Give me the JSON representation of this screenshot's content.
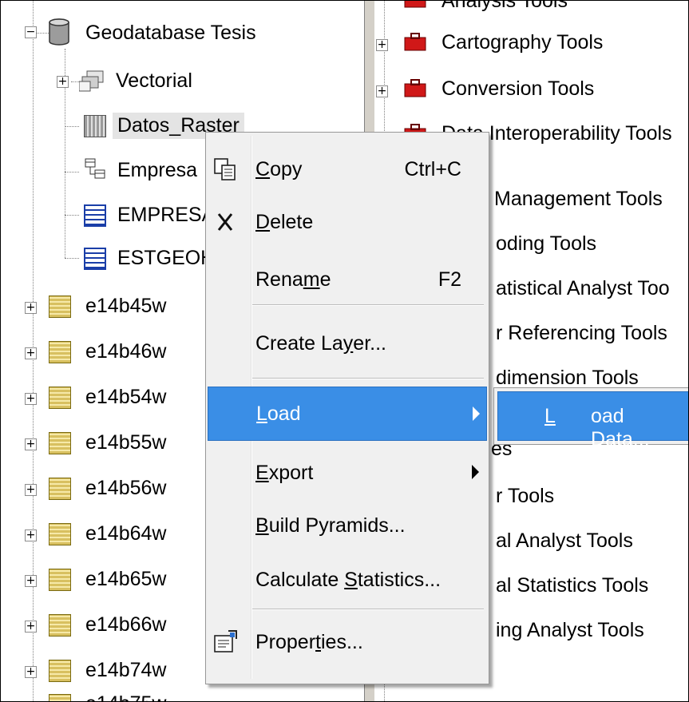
{
  "tree": {
    "root_label": "Geodatabase Tesis",
    "children": [
      {
        "label": "Vectorial",
        "icon": "feature-dataset-icon",
        "expander": "+"
      },
      {
        "label": "Datos_Raster",
        "icon": "raster-catalog-icon"
      },
      {
        "label": "Empresa",
        "icon": "relationship-class-icon"
      },
      {
        "label": "EMPRESA",
        "icon": "table-icon"
      },
      {
        "label": "ESTGEOH",
        "icon": "table-icon"
      }
    ],
    "rasters": [
      "e14b45w",
      "e14b46w",
      "e14b54w",
      "e14b55w",
      "e14b56w",
      "e14b64w",
      "e14b65w",
      "e14b66w",
      "e14b74w",
      "e14b75w"
    ],
    "expander_symbol": "+",
    "root_expander_symbol": "−"
  },
  "toolbox": {
    "items": [
      "Analysis Tools",
      "Cartography Tools",
      "Conversion Tools",
      "Data Interoperability Tools",
      "Data Management Tools",
      "Geocoding Tools",
      "Geostatistical Analyst Tools",
      "Linear Referencing Tools",
      "Multidimension Tools",
      "Network Analyst Tools",
      "Parcel Fabric Tools",
      "Server Tools",
      "Spatial Analyst Tools",
      "Spatial Statistics Tools",
      "Tracking Analyst Tools"
    ],
    "visible_fragments": [
      "Analysis Tools",
      "Cartography Tools",
      "Conversion Tools",
      "Data Interoperability Tools",
      "Management Tools",
      "oding Tools",
      "atistical Analyst Too",
      "r Referencing Tools",
      "dimension Tools",
      "es",
      "r Tools",
      "al Analyst Tools",
      "al Statistics Tools",
      "ing Analyst Tools"
    ]
  },
  "context_menu": {
    "copy": {
      "pre": "",
      "ul": "C",
      "post": "opy",
      "shortcut": "Ctrl+C"
    },
    "delete": {
      "pre": "",
      "ul": "D",
      "post": "elete"
    },
    "rename": {
      "pre": "Rena",
      "ul": "m",
      "post": "e",
      "shortcut": "F2"
    },
    "create_layer": {
      "pre": "Create La",
      "ul": "y",
      "post": "er..."
    },
    "load": {
      "pre": "",
      "ul": "L",
      "post": "oad"
    },
    "export": {
      "pre": "",
      "ul": "E",
      "post": "xport"
    },
    "build_pyramids": {
      "pre": "",
      "ul": "B",
      "post": "uild Pyramids..."
    },
    "calculate_statistics": {
      "pre": "Calculate ",
      "ul": "S",
      "post": "tatistics..."
    },
    "properties": {
      "pre": "Proper",
      "ul": "t",
      "post": "ies..."
    }
  },
  "submenu": {
    "load_data": {
      "pre": "",
      "ul": "L",
      "post": "oad Data..."
    }
  },
  "colors": {
    "highlight": "#3a8ee6",
    "selection": "#e4e4e4",
    "menu_bg": "#f0f0f0"
  }
}
